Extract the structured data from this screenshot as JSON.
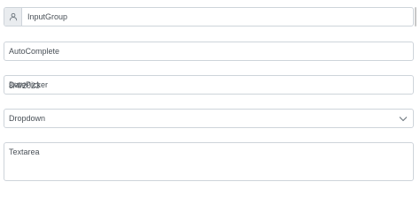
{
  "input_group": {
    "icon": "user-icon",
    "placeholder": "InputGroup"
  },
  "autocomplete": {
    "placeholder": "AutoComplete"
  },
  "datepicker": {
    "placeholder": "DatePicker",
    "value": "8/4/2023"
  },
  "dropdown": {
    "label": "Dropdown",
    "icon": "chevron-down-icon"
  },
  "textarea": {
    "placeholder": "Textarea"
  }
}
